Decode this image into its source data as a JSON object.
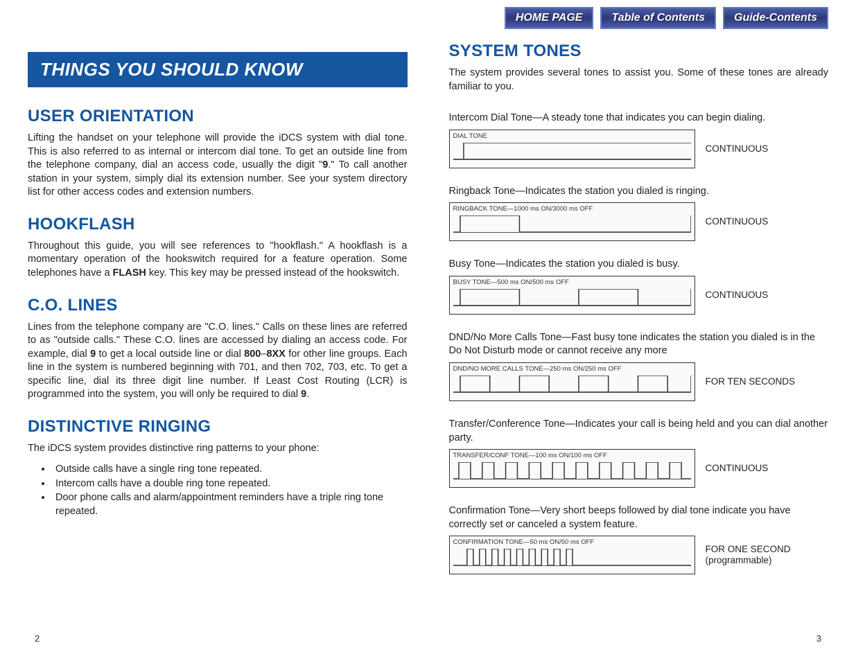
{
  "nav": {
    "home": "HOME PAGE",
    "toc": "Table of Contents",
    "guide": "Guide-Contents"
  },
  "left": {
    "banner": "THINGS YOU SHOULD KNOW",
    "sections": {
      "user_orientation": {
        "heading": "USER ORIENTATION",
        "body_pre": "Lifting the handset on your telephone will provide the iDCS system with dial tone. This is also referred to as internal or intercom dial tone. To get an outside line from the telephone company, dial an access code, usually the digit \"",
        "bold1": "9",
        "body_post": ".\" To call another station in your system, simply dial its extension number. See your system directory list for other access codes and extension numbers."
      },
      "hookflash": {
        "heading": "HOOKFLASH",
        "body_pre": "Throughout this guide, you will see references to \"hookflash.\" A hookflash is a momentary operation of the hookswitch required for a feature operation. Some telephones have a ",
        "bold1": "FLASH",
        "body_post": " key. This key may be pressed instead of the hookswitch."
      },
      "co_lines": {
        "heading": "C.O. LINES",
        "body_pre": "Lines from the telephone company are \"C.O. lines.\" Calls on these lines are referred to as \"outside calls.\" These C.O. lines are accessed by dialing an access code. For example, dial ",
        "bold1": "9",
        "body_mid1": " to get a local outside line or dial ",
        "bold2": "800",
        "dash": "–",
        "bold3": "8XX",
        "body_mid2": " for other line groups. Each line in the system is numbered beginning with 701, and then 702, 703, etc. To get a specific line, dial its three digit line number. If Least Cost Routing (LCR) is programmed into the system, you will only be required to dial ",
        "bold4": "9",
        "body_post": "."
      },
      "distinctive": {
        "heading": "DISTINCTIVE RINGING",
        "intro": "The iDCS system provides distinctive ring patterns to your phone:",
        "bullets": [
          "Outside calls have a single ring tone repeated.",
          "Intercom calls have a double ring tone repeated.",
          "Door phone calls and alarm/appointment reminders have a triple ring tone repeated."
        ]
      }
    }
  },
  "right": {
    "heading": "SYSTEM TONES",
    "intro": "The system provides several tones to assist you. Some of these tones are already familiar to you.",
    "tones": [
      {
        "desc": "Intercom Dial Tone—A steady tone that indicates you can begin dialing.",
        "label": "DIAL TONE",
        "status": "CONTINUOUS",
        "pattern": "dial"
      },
      {
        "desc": "Ringback Tone—Indicates the station you dialed is ringing.",
        "label": "RINGBACK TONE—1000 ms ON/3000 ms OFF",
        "status": "CONTINUOUS",
        "pattern": "ringback"
      },
      {
        "desc": "Busy Tone—Indicates the station you dialed is busy.",
        "label": "BUSY TONE—500 ms ON/500 ms OFF",
        "status": "CONTINUOUS",
        "pattern": "busy"
      },
      {
        "desc": "DND/No More Calls Tone—Fast busy tone indicates the station you dialed is in the Do Not Disturb mode or cannot receive any more",
        "label": "DND/NO MORE CALLS TONE—250 ms ON/250 ms OFF",
        "status": "FOR TEN SECONDS",
        "pattern": "dnd"
      },
      {
        "desc": "Transfer/Conference Tone—Indicates your call is being held and you can dial another party.",
        "label": "TRANSFER/CONF TONE—100 ms ON/100 ms OFF",
        "status": "CONTINUOUS",
        "pattern": "transfer"
      },
      {
        "desc": "Confirmation Tone—Very short beeps followed by dial tone indicate you have correctly set or canceled a system feature.",
        "label": "CONFIRMATION TONE—50 ms ON/50 ms OFF",
        "status": "FOR ONE SECOND (programmable)",
        "pattern": "confirm"
      }
    ]
  },
  "pages": {
    "left": "2",
    "right": "3"
  }
}
